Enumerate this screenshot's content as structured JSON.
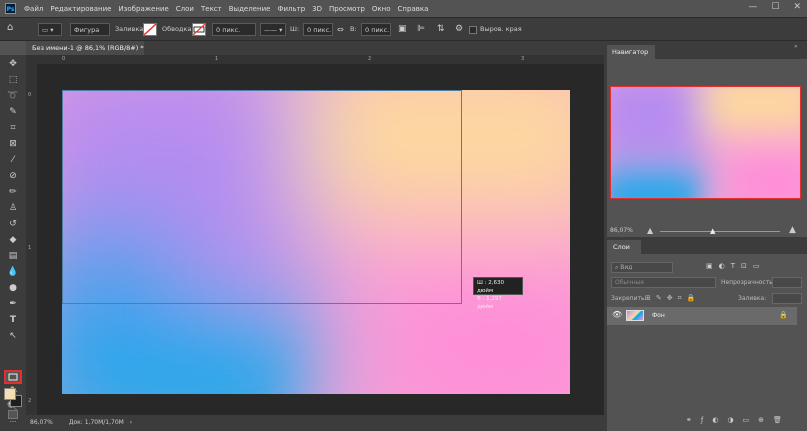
{
  "app": {
    "logo": "Ps"
  },
  "menu": {
    "items": [
      "Файл",
      "Редактирование",
      "Изображение",
      "Слои",
      "Текст",
      "Выделение",
      "Фильтр",
      "3D",
      "Просмотр",
      "Окно",
      "Справка"
    ]
  },
  "window_controls": {
    "minimize": "—",
    "maximize": "☐",
    "close": "✕"
  },
  "options": {
    "mode": "Фигура",
    "fill_label": "Заливка:",
    "stroke_label": "Обводка:",
    "stroke_width": "0 пикс.",
    "w_label": "Ш:",
    "w_value": "0 пикс.",
    "h_label": "В:",
    "h_value": "0 пикс.",
    "align_edges": "Выров. края"
  },
  "document": {
    "tab_title": "Без имени-1 @ 86,1% (RGB/8#) *",
    "close": "×"
  },
  "rulers": {
    "h": [
      "0",
      "1",
      "2",
      "3"
    ],
    "v": [
      "0",
      "1",
      "2"
    ]
  },
  "size_tooltip": {
    "w_line": "Ш :   2,630 дюйм",
    "h_line": "В :   1,297 дюйм"
  },
  "status": {
    "zoom": "86,07%",
    "doc": "Док: 1,70M/1,70M"
  },
  "navigator": {
    "title": "Навигатор",
    "zoom": "86,07%"
  },
  "layers": {
    "title": "Слои",
    "filter_placeholder": "Вид",
    "blend_mode": "Обычные",
    "opacity_label": "Непрозрачность:",
    "lock_label": "Закрепить:",
    "fill_label": "Заливка:",
    "layer_name": "Фон"
  },
  "colors": {
    "accent": "#31a8ff",
    "selection": "#4d7fa8",
    "highlight": "#e03030",
    "foreground": "#f5deb3",
    "background": "#1e1e1e"
  }
}
